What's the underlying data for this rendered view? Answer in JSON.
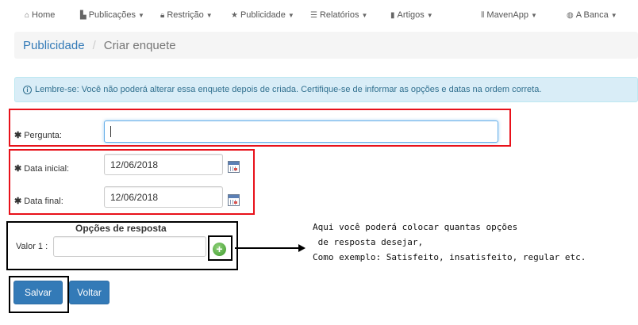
{
  "nav": {
    "items": [
      {
        "icon": "home-icon",
        "glyph": "⌂",
        "label": "Home",
        "caret": false
      },
      {
        "icon": "document-icon",
        "glyph": "▙",
        "label": "Publicações",
        "caret": true
      },
      {
        "icon": "lock-icon",
        "glyph": "🔒︎",
        "label": "Restrição",
        "caret": true
      },
      {
        "icon": "star-icon",
        "glyph": "★",
        "label": "Publicidade",
        "caret": true
      },
      {
        "icon": "list-icon",
        "glyph": "☰",
        "label": "Relatórios",
        "caret": true
      },
      {
        "icon": "bookmark-icon",
        "glyph": "▮",
        "label": "Artigos",
        "caret": true
      },
      {
        "icon": "barcode-icon",
        "glyph": "⦀",
        "label": "MavenApp",
        "caret": true
      },
      {
        "icon": "globe-icon",
        "glyph": "◍",
        "label": "A Banca",
        "caret": true
      }
    ]
  },
  "breadcrumb": {
    "parent": "Publicidade",
    "separator": "/",
    "current": "Criar enquete"
  },
  "alert": {
    "icon": "info-icon",
    "text": "Lembre-se: Você não poderá alterar essa enquete depois de criada. Certifique-se de informar as opções e datas na ordem correta."
  },
  "form": {
    "required_mark": "✱",
    "pergunta_label": "Pergunta:",
    "pergunta_value": "",
    "data_inicial_label": "Data inicial:",
    "data_inicial_value": "12/06/2018",
    "data_final_label": "Data final:",
    "data_final_value": "12/06/2018"
  },
  "options": {
    "title": "Opções de resposta",
    "valor_label": "Valor 1 :",
    "valor_value": "",
    "add_glyph": "+"
  },
  "annotation": {
    "line1": "Aqui você poderá colocar quantas opções",
    "line2": " de resposta desejar,",
    "line3": "Como exemplo: Satisfeito, insatisfeito, regular etc."
  },
  "buttons": {
    "save": "Salvar",
    "back": "Voltar"
  },
  "colors": {
    "primary": "#337ab7",
    "annotation_red": "#e8111a",
    "info_bg": "#d9edf7"
  }
}
